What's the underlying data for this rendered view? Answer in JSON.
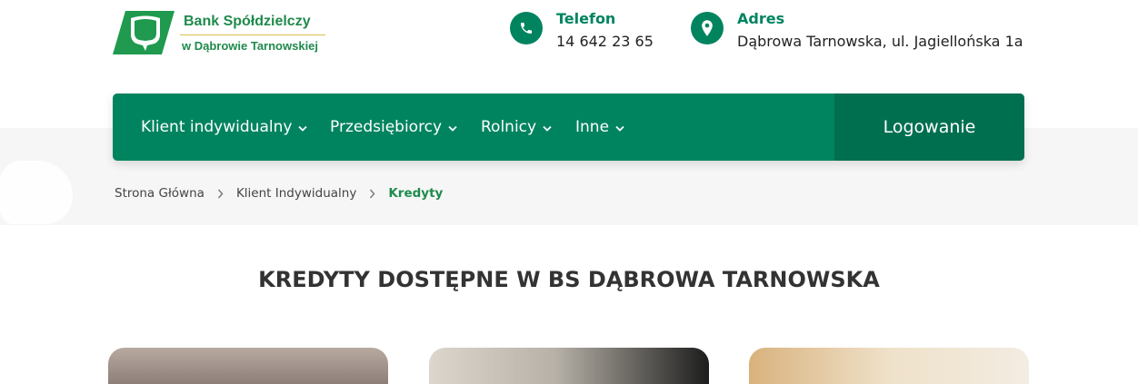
{
  "brand": {
    "line1": "Bank Spółdzielczy",
    "line2": "w Dąbrowie Tarnowskiej",
    "colors": {
      "primary": "#00845f",
      "primary_dark": "#006f50",
      "logo_green": "#1f8a4c",
      "logo_rule": "#d9c04a"
    }
  },
  "contact": {
    "phone": {
      "label": "Telefon",
      "value": "14 642 23 65",
      "icon": "phone-icon"
    },
    "address": {
      "label": "Adres",
      "value": "Dąbrowa Tarnowska, ul. Jagiellońska 1a",
      "icon": "location-pin-icon"
    }
  },
  "nav": {
    "items": [
      {
        "label": "Klient indywidualny",
        "icon": "chevron-down-icon"
      },
      {
        "label": "Przedsiębiorcy",
        "icon": "chevron-down-icon"
      },
      {
        "label": "Rolnicy",
        "icon": "chevron-down-icon"
      },
      {
        "label": "Inne",
        "icon": "chevron-down-icon"
      }
    ],
    "login_label": "Logowanie"
  },
  "breadcrumb": {
    "items": [
      "Strona Główna",
      "Klient Indywidualny",
      "Kredyty"
    ],
    "separator_icon": "chevron-right-icon"
  },
  "main": {
    "title": "KREDYTY DOSTĘPNE W BS DĄBROWA TARNOWSKA"
  }
}
